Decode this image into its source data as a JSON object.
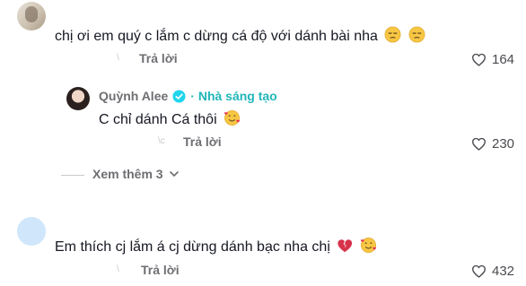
{
  "comments": [
    {
      "text": "chị ơi em quý c lắm c dừng cá độ với dánh bài nha",
      "emojis": [
        "pensive-face",
        "pensive-face"
      ],
      "reply_label": "Trả lời",
      "faint_label": "\\",
      "likes": "164"
    },
    {
      "username": "Quỳnh Alee",
      "badge": "verified-icon",
      "creator_label": "· Nhà sáng tạo",
      "text": "C chỉ dánh Cá thôi",
      "emojis": [
        "smiling-face-with-hearts"
      ],
      "reply_label": "Trả lời",
      "faint_label": "\\c",
      "likes": "230"
    },
    {
      "text": "Em thích cj lắm á cj dừng dánh bạc nha chị",
      "emojis": [
        "broken-heart",
        "smiling-face-with-hearts"
      ],
      "reply_label": "Trả lời",
      "faint_label": "\\",
      "likes": "432"
    }
  ],
  "view_more": {
    "label": "Xem thêm 3"
  },
  "colors": {
    "creator": "#21b6b9",
    "meta": "#6e6e73",
    "heart_broken": "#d6334b"
  }
}
